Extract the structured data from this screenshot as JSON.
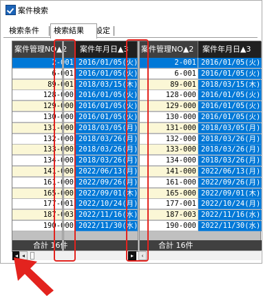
{
  "window": {
    "title": "案件検索"
  },
  "tabs": [
    {
      "label": "検索条件",
      "active": false
    },
    {
      "label": "検索結果",
      "active": true
    },
    {
      "label": "設定",
      "active": false
    }
  ],
  "grid_left": {
    "columns": [
      {
        "label": "案件管理NO▲2",
        "sorted": false
      },
      {
        "label": "案件年月日▲3",
        "sorted": true
      }
    ],
    "footer": "合計 16件"
  },
  "grid_right": {
    "columns": [
      {
        "label": "案件管理NO▲2",
        "sorted": false
      },
      {
        "label": "案件年月日▲3",
        "sorted": true
      }
    ],
    "footer": "合計 16件"
  },
  "rows": [
    {
      "id": "2-001",
      "date": "2016/01/05(火)"
    },
    {
      "id": "6-001",
      "date": "2016/01/05(火)"
    },
    {
      "id": "89-001",
      "date": "2018/03/15(木)"
    },
    {
      "id": "128-000",
      "date": "2016/01/05(火)"
    },
    {
      "id": "129-000",
      "date": "2016/01/05(火)"
    },
    {
      "id": "130-000",
      "date": "2016/01/05(火)"
    },
    {
      "id": "131-000",
      "date": "2018/03/05(月)"
    },
    {
      "id": "132-000",
      "date": "2018/03/26(月)"
    },
    {
      "id": "133-000",
      "date": "2018/03/26(月)"
    },
    {
      "id": "134-000",
      "date": "2018/03/26(月)"
    },
    {
      "id": "141-000",
      "date": "2022/06/13(月)"
    },
    {
      "id": "161-000",
      "date": "2022/09/26(月)"
    },
    {
      "id": "165-000",
      "date": "2022/09/01(木)"
    },
    {
      "id": "177-001",
      "date": "2022/10/24(月)"
    },
    {
      "id": "187-003",
      "date": "2022/11/16(水)"
    },
    {
      "id": "190-000",
      "date": "2022/11/30(水)"
    }
  ],
  "scrollbar": {
    "left_arrow": "◂",
    "right_arrow": "▸",
    "left_arrow_2": "‹"
  },
  "colors": {
    "selection": "#0078d7",
    "header": "#404040",
    "highlight_box": "#e3231e",
    "arrow": "#e3231e",
    "odd_row": "#fbf7d6"
  },
  "icons": {
    "app": "app-check-icon",
    "pointer": "red-arrow-pointer"
  }
}
